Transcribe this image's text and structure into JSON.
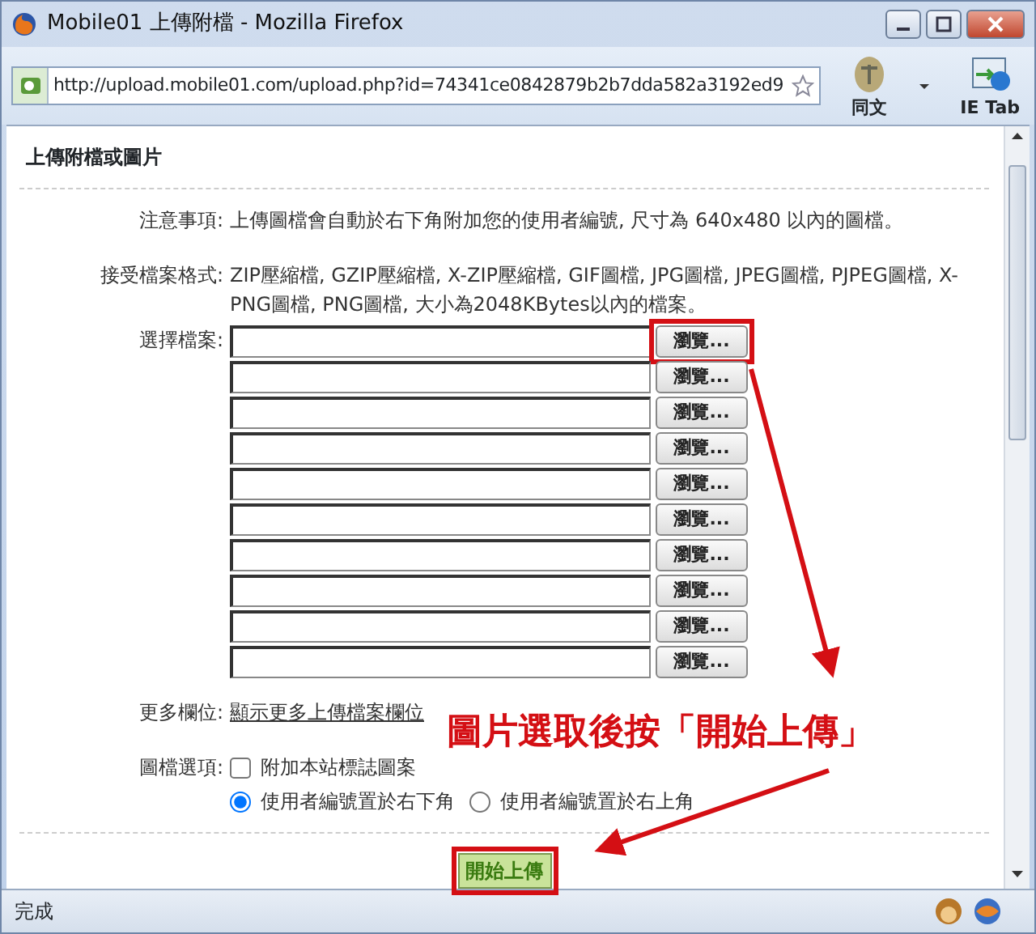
{
  "window": {
    "title": "Mobile01 上傳附檔 - Mozilla Firefox"
  },
  "address_bar": {
    "url": "http://upload.mobile01.com/upload.php?id=74341ce0842879b2b7dda582a3192ed9"
  },
  "toolbar_buttons": [
    {
      "label": "同文",
      "kind": "tongwen"
    },
    {
      "label": "IE Tab",
      "kind": "ietab"
    }
  ],
  "form": {
    "heading": "上傳附檔或圖片",
    "notice": {
      "label": "注意事項:",
      "text": "上傳圖檔會自動於右下角附加您的使用者編號, 尺寸為 640x480 以內的圖檔。"
    },
    "formats": {
      "label": "接受檔案格式:",
      "text": "ZIP壓縮檔, GZIP壓縮檔, X-ZIP壓縮檔, GIF圖檔, JPG圖檔, JPEG圖檔, PJPEG圖檔, X-PNG圖檔, PNG圖檔, 大小為2048KBytes以內的檔案。"
    },
    "file_label": "選擇檔案:",
    "file_rows": [
      {
        "button": "瀏覽...",
        "highlighted": true
      },
      {
        "button": "瀏覽...",
        "highlighted": false
      },
      {
        "button": "瀏覽...",
        "highlighted": false
      },
      {
        "button": "瀏覽...",
        "highlighted": false
      },
      {
        "button": "瀏覽...",
        "highlighted": false
      },
      {
        "button": "瀏覽...",
        "highlighted": false
      },
      {
        "button": "瀏覽...",
        "highlighted": false
      },
      {
        "button": "瀏覽...",
        "highlighted": false
      },
      {
        "button": "瀏覽...",
        "highlighted": false
      },
      {
        "button": "瀏覽...",
        "highlighted": false
      }
    ],
    "more": {
      "label": "更多欄位:",
      "link": "顯示更多上傳檔案欄位"
    },
    "options": {
      "label": "圖檔選項:",
      "checkbox": {
        "label": "附加本站標誌圖案",
        "checked": false
      },
      "radios": [
        {
          "label": "使用者編號置於右下角",
          "selected": true
        },
        {
          "label": "使用者編號置於右上角",
          "selected": false
        }
      ]
    },
    "submit": {
      "label": "開始上傳",
      "highlighted": true
    }
  },
  "annotation": {
    "text": "圖片選取後按「開始上傳」"
  },
  "status_bar": {
    "text": "完成"
  }
}
